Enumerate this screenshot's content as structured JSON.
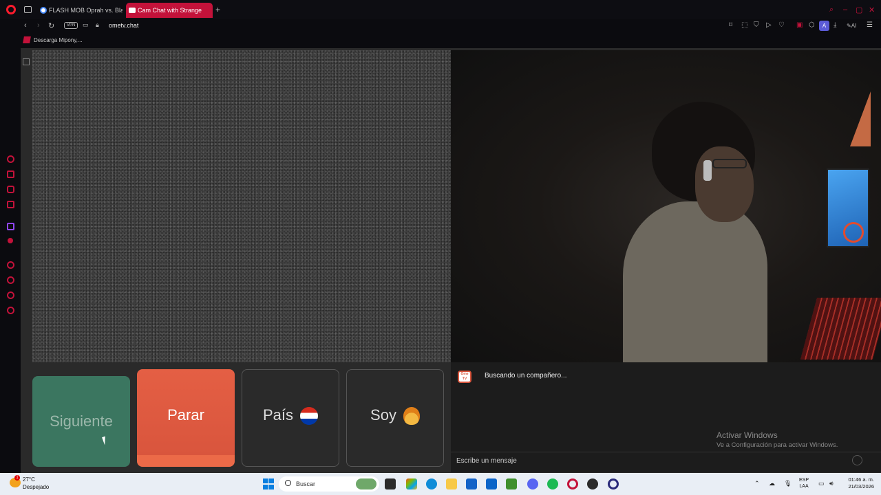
{
  "browser": {
    "tabs": [
      {
        "label": "FLASH MOB Oprah vs. Bla"
      },
      {
        "label": "Cam Chat with Strange"
      }
    ],
    "address": {
      "vpn_label": "VPN",
      "url": "ometv.chat"
    },
    "toolbar": {
      "ai_badge": "A",
      "ai_label": "AI"
    },
    "bookmarks": [
      {
        "label": "Descarga Mipony,..."
      }
    ]
  },
  "video_chat": {
    "buttons": {
      "next_label": "Siguiente",
      "stop_label": "Parar",
      "country_label": "País",
      "gender_label": "Soy"
    },
    "chat": {
      "logo_text": "Ome TV",
      "status": "Buscando un compañero...",
      "input_placeholder": "Escribe un mensaje"
    },
    "watermark": {
      "title": "Activar Windows",
      "subtitle": "Ve a Configuración para activar Windows."
    }
  },
  "taskbar": {
    "weather": {
      "badge": "1",
      "temp": "27°C",
      "condition": "Despejado"
    },
    "search_label": "Buscar",
    "language": {
      "line1": "ESP",
      "line2": "LAA"
    },
    "clock": {
      "time": "01:46 a. m.",
      "date": "21/03/2026"
    }
  },
  "colors": {
    "opera_red": "#c3123a",
    "next_green": "#3b7660",
    "stop_orange": "#e45f44",
    "taskbar_bg": "#e9eef5"
  },
  "icons": [
    "opera-logo-icon",
    "workspaces-icon",
    "back-icon",
    "forward-icon",
    "reload-icon",
    "lock-icon",
    "camera-icon",
    "flag-paraguay-icon",
    "avatar-icon",
    "windows-start-icon",
    "search-icon"
  ]
}
